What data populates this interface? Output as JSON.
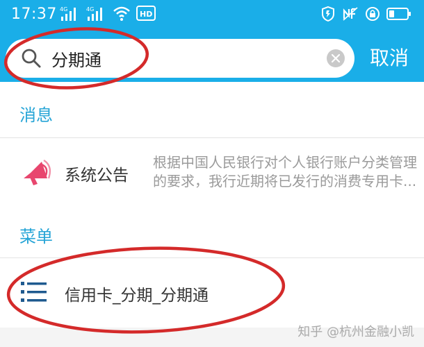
{
  "status_bar": {
    "time": "17:37",
    "network_1": "4G",
    "network_2": "4G",
    "hd_badge": "HD",
    "icons": [
      "signal-icon",
      "signal-icon",
      "wifi-icon",
      "hd-icon",
      "shield-icon",
      "nfc-icon",
      "lock-icon",
      "battery-icon"
    ]
  },
  "search": {
    "value": "分期通",
    "cancel_label": "取消"
  },
  "sections": {
    "messages": {
      "title": "消息",
      "item": {
        "icon": "megaphone-icon",
        "title": "系统公告",
        "preview_line1": "根据中国人民银行对个人银行账户分类管理",
        "preview_line2": "的要求，我行近期将已发行的消费专用卡..."
      }
    },
    "menu": {
      "title": "菜单",
      "item": {
        "icon": "list-icon",
        "label": "信用卡_分期_分期通"
      }
    }
  },
  "watermark": "知乎 @杭州金融小凯",
  "colors": {
    "header_blue": "#1aaee8",
    "section_title": "#25a4d6",
    "annotation_red": "#d42a2a",
    "megaphone_pink": "#e8466e"
  }
}
